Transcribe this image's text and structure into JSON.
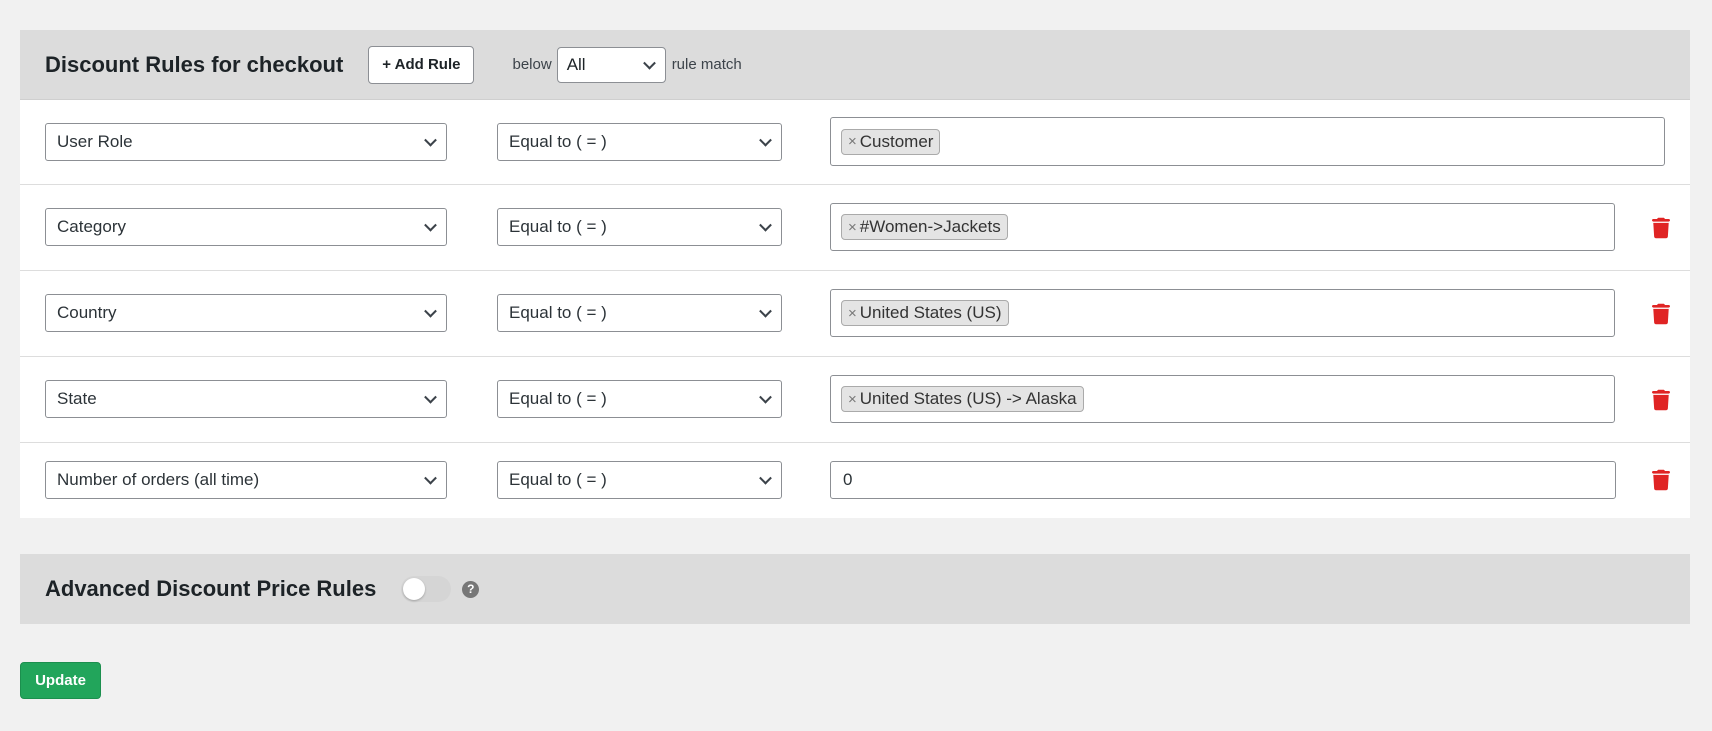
{
  "rules_panel": {
    "title": "Discount Rules for checkout",
    "add_rule_label": "+ Add Rule",
    "below_label": "below",
    "match_select_value": "All",
    "rule_match_label": "rule match"
  },
  "rules": [
    {
      "field": "User Role",
      "operator": "Equal to ( = )",
      "value_tag": "Customer",
      "tag_remove": "×",
      "deletable": false
    },
    {
      "field": "Category",
      "operator": "Equal to ( = )",
      "value_tag": "#Women->Jackets",
      "tag_remove": "×",
      "deletable": true
    },
    {
      "field": "Country",
      "operator": "Equal to ( = )",
      "value_tag": "United States (US)",
      "tag_remove": "×",
      "deletable": true
    },
    {
      "field": "State",
      "operator": "Equal to ( = )",
      "value_tag": "United States (US) -> Alaska",
      "tag_remove": "×",
      "deletable": true
    },
    {
      "field": "Number of orders (all time)",
      "operator": "Equal to ( = )",
      "value_input": "0",
      "deletable": true
    }
  ],
  "advanced_panel": {
    "title": "Advanced Discount Price Rules",
    "toggle_on": false,
    "help_glyph": "?"
  },
  "update_label": "Update",
  "colors": {
    "trash": "#e02424",
    "update_button": "#22a55b",
    "header_bg": "#dcdcdc"
  },
  "icons": {
    "trash": "trash-icon",
    "chevron": "chevron-down-icon",
    "help": "help-icon"
  }
}
